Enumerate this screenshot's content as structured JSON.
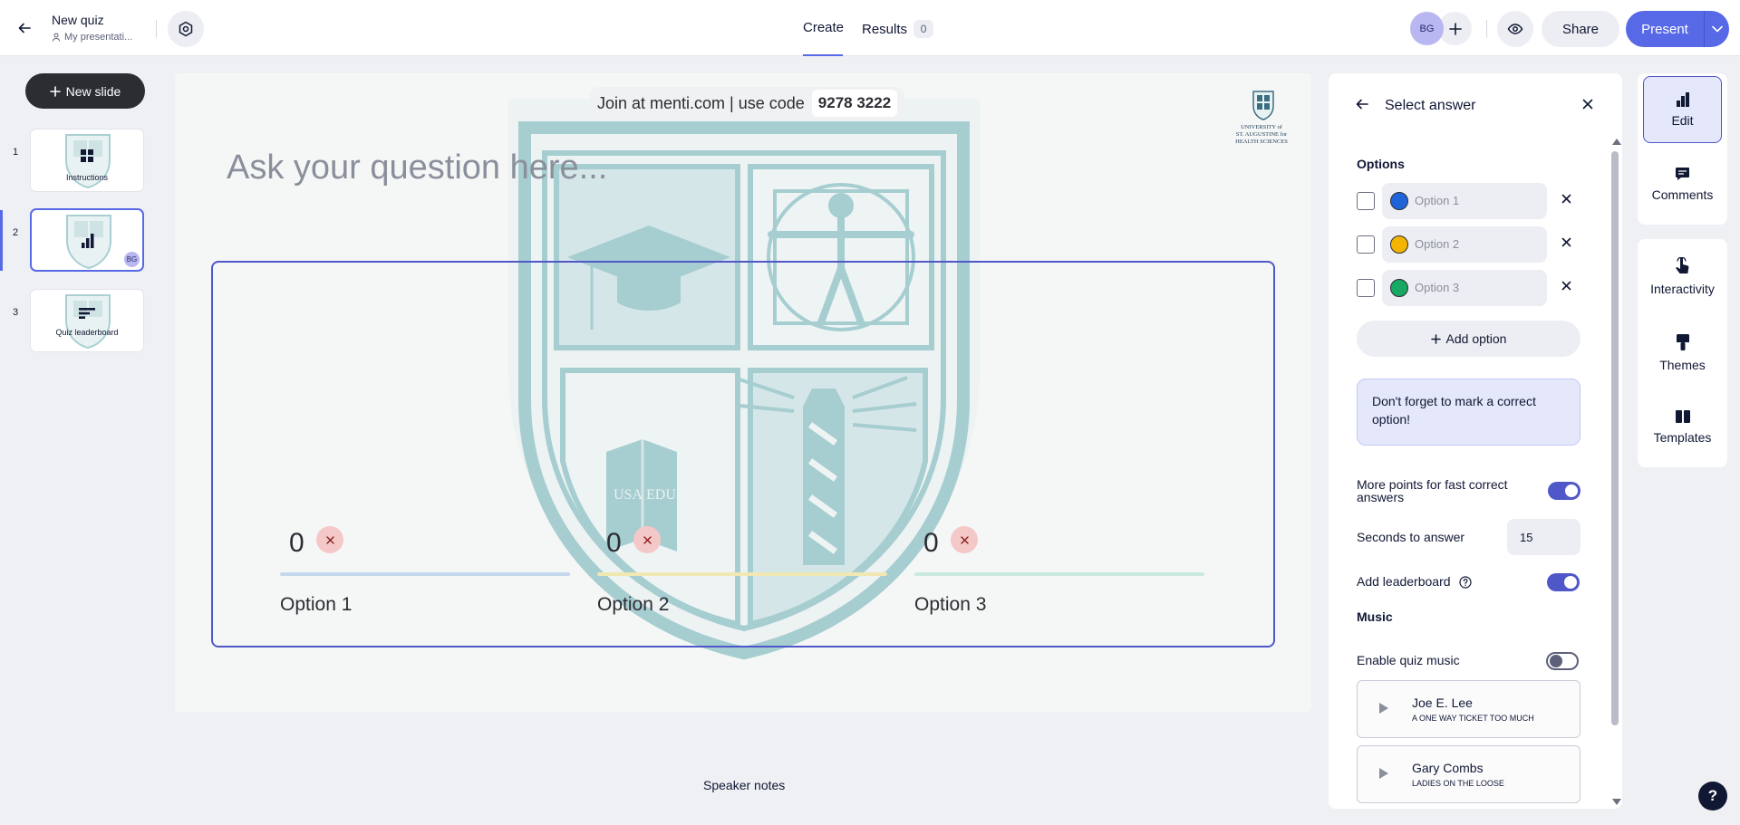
{
  "header": {
    "title": "New quiz",
    "folder": "My presentati...",
    "tabs": {
      "create": "Create",
      "results": "Results",
      "results_count": "0"
    },
    "avatar_initials": "BG",
    "share_label": "Share",
    "present_label": "Present"
  },
  "sidebar": {
    "new_slide_label": "New slide",
    "slides": [
      {
        "number": "1",
        "label": "Instructions"
      },
      {
        "number": "2",
        "label": "",
        "badge": "BG"
      },
      {
        "number": "3",
        "label": "Quiz leaderboard"
      }
    ]
  },
  "canvas": {
    "join_text": "Join at menti.com | use code",
    "join_code": "9278 3222",
    "question_placeholder": "Ask your question here...",
    "options": [
      {
        "label": "Option 1",
        "count": "0",
        "color": "#c5d7ec"
      },
      {
        "label": "Option 2",
        "count": "0",
        "color": "#f1e7b3"
      },
      {
        "label": "Option 3",
        "count": "0",
        "color": "#cbe9df"
      }
    ],
    "logo_text": [
      "UNIVERSITY of",
      "ST. AUGUSTINE for",
      "HEALTH SCIENCES"
    ],
    "crest_text": [
      "USA",
      "EDU"
    ],
    "speaker_notes": "Speaker notes"
  },
  "panel": {
    "title": "Select answer",
    "options_heading": "Options",
    "options": [
      {
        "placeholder": "Option 1",
        "color": "#1f63d8"
      },
      {
        "placeholder": "Option 2",
        "color": "#f4b400"
      },
      {
        "placeholder": "Option 3",
        "color": "#17a863"
      }
    ],
    "add_option_label": "Add option",
    "hint": "Don't forget to mark a correct option!",
    "fast_points_label": "More points for fast correct answers",
    "fast_points_enabled": true,
    "seconds_label": "Seconds to answer",
    "seconds_value": "15",
    "leaderboard_label": "Add leaderboard",
    "leaderboard_enabled": true,
    "music_heading": "Music",
    "quiz_music_label": "Enable quiz music",
    "quiz_music_enabled": false,
    "tracks": [
      {
        "artist": "Joe E. Lee",
        "title": "A ONE WAY TICKET TOO MUCH"
      },
      {
        "artist": "Gary Combs",
        "title": "LADIES ON THE LOOSE"
      }
    ]
  },
  "rail": {
    "edit": "Edit",
    "comments": "Comments",
    "interactivity": "Interactivity",
    "themes": "Themes",
    "templates": "Templates"
  },
  "help_label": "?",
  "colors": {
    "accent": "#5769e7",
    "selection_border": "#5057c8",
    "crest": "#9fcacd"
  }
}
